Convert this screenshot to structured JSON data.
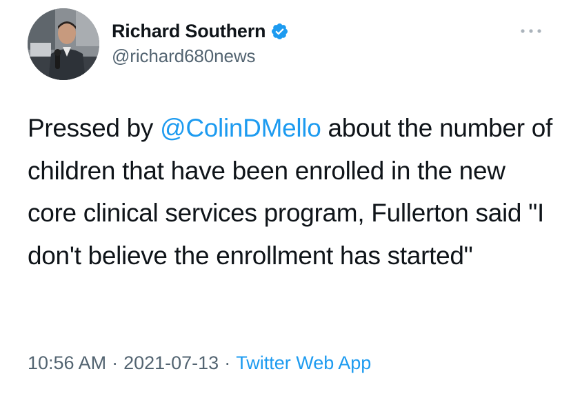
{
  "author": {
    "display_name": "Richard Southern",
    "handle": "@richard680news",
    "verified": true
  },
  "tweet": {
    "text_before_mention": "Pressed by ",
    "mention": "@ColinDMello",
    "text_after_mention": " about the number of children that have been enrolled in the new core clinical services program, Fullerton said \"I don't believe the enrollment has started\""
  },
  "meta": {
    "time": "10:56 AM",
    "separator": "·",
    "date": "2021-07-13",
    "source": "Twitter Web App"
  },
  "icons": {
    "verified": "verified-badge-icon",
    "more": "more-options-icon"
  },
  "colors": {
    "accent": "#1d9bf0",
    "text_primary": "#0f1419",
    "text_secondary": "#536471"
  }
}
